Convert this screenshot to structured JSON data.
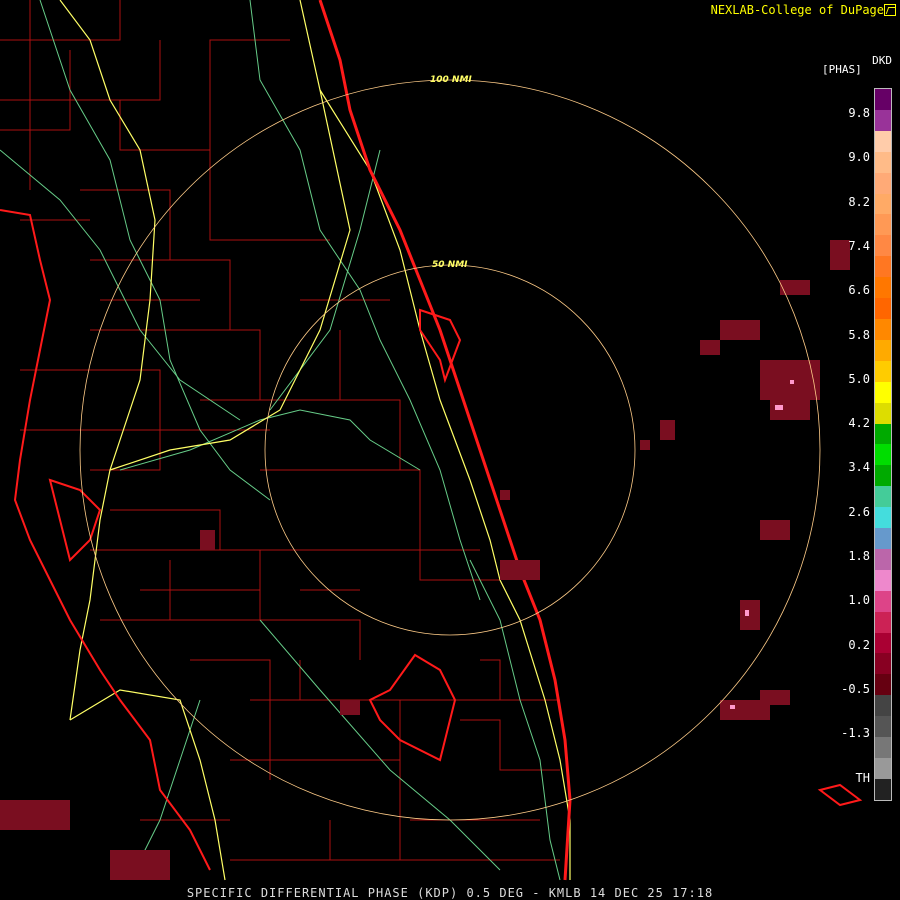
{
  "header": {
    "title": "NEXLAB-College of DuPage",
    "icon": "logo-icon"
  },
  "product": {
    "unit_top": "DKD",
    "unit_label": "[PHAS]"
  },
  "scale": {
    "ticks": [
      "9.8",
      "9.0",
      "8.2",
      "7.4",
      "6.6",
      "5.8",
      "5.0",
      "4.2",
      "3.4",
      "2.6",
      "1.8",
      "1.0",
      "0.2",
      "-0.5",
      "-1.3",
      "TH"
    ],
    "colors": [
      "#660066",
      "#993399",
      "#ffccaa",
      "#ffbb88",
      "#ffaa77",
      "#ffaa66",
      "#ff9955",
      "#ff8844",
      "#ff7722",
      "#ff7700",
      "#ff6600",
      "#ff8800",
      "#ffaa00",
      "#ffcc00",
      "#ffff00",
      "#dddd00",
      "#00aa00",
      "#00dd00",
      "#00aa00",
      "#44cc99",
      "#44dddd",
      "#6699cc",
      "#bb66aa",
      "#ee88cc",
      "#dd4488",
      "#cc2255",
      "#aa0033",
      "#880022",
      "#660011",
      "#444444",
      "#555555",
      "#777777",
      "#999999",
      "#222222"
    ]
  },
  "rings": {
    "inner_label": "50 NMI",
    "outer_label": "100 NMI"
  },
  "footer": {
    "text": "SPECIFIC DIFFERENTIAL PHASE (KDP) 0.5 DEG - KMLB 14 DEC 25 17:18"
  },
  "colors": {
    "coast": "#ff1a1a",
    "county": "#aa1111",
    "interstate": "#ffff66",
    "highway": "#66cc88",
    "ring": "#ffcc88",
    "echo": "#7a0e20",
    "echo_hi": "#ff99cc"
  }
}
